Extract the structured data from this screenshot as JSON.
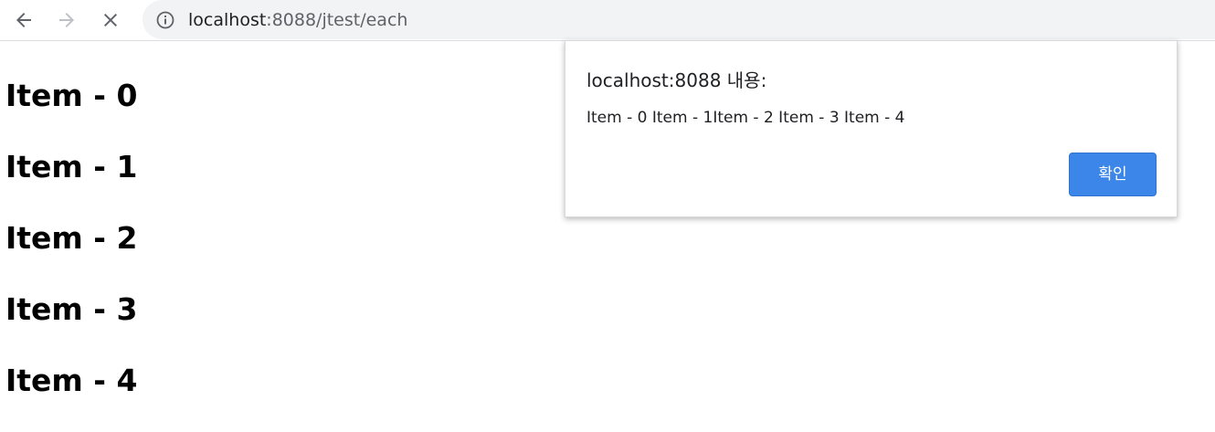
{
  "browser": {
    "url_host": "localhost",
    "url_path": ":8088/jtest/each",
    "icons": {
      "back": "arrow-left-icon",
      "forward": "arrow-right-icon",
      "stop": "close-icon",
      "site_info": "info-icon"
    }
  },
  "page": {
    "items": [
      "Item - 0",
      "Item - 1",
      "Item - 2",
      "Item - 3",
      "Item - 4"
    ]
  },
  "dialog": {
    "title": "localhost:8088 내용:",
    "message": "Item - 0 Item - 1Item - 2 Item - 3 Item - 4",
    "ok_label": "확인",
    "button_color": "#3b86e8"
  }
}
